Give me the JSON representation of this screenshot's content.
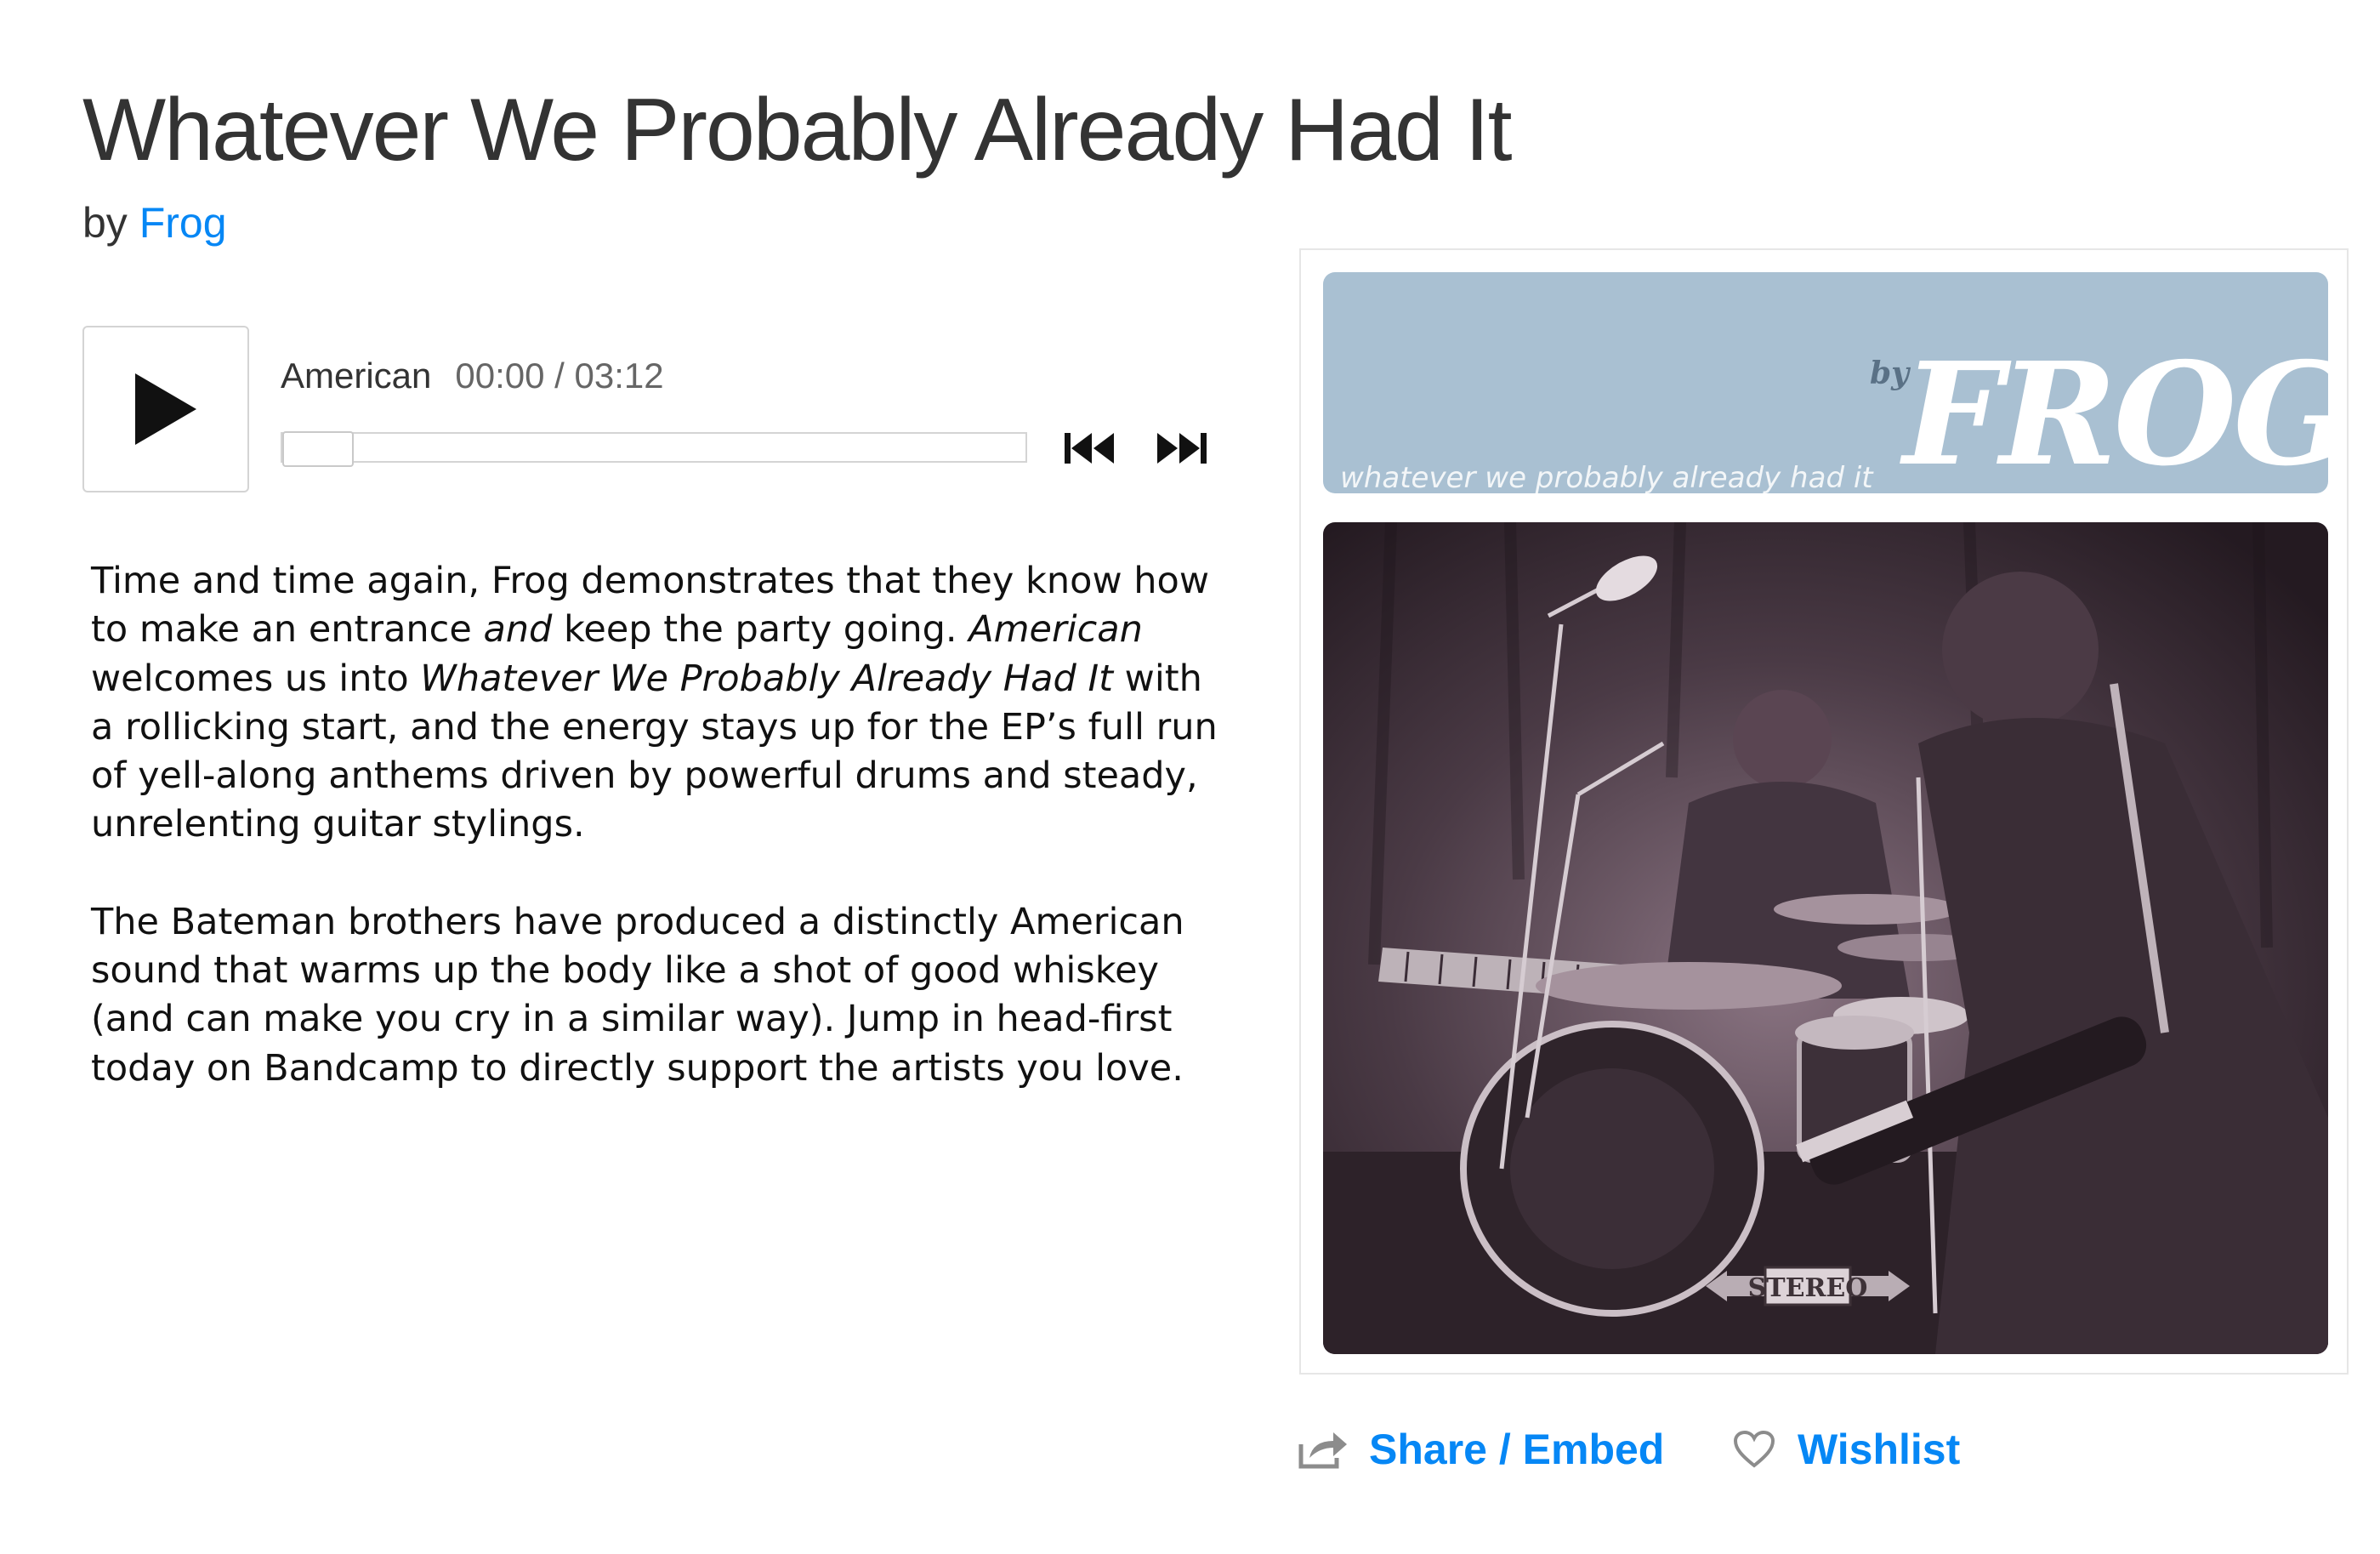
{
  "album": {
    "title": "Whatever We Probably Already Had It",
    "by_prefix": "by",
    "artist": "Frog"
  },
  "player": {
    "track_title": "American",
    "time_display": "00:00 / 03:12",
    "progress": 0,
    "icons": {
      "play": "play-icon",
      "previous": "skip-previous-icon",
      "next": "skip-next-icon"
    }
  },
  "description": {
    "p1": [
      {
        "text": "Time and time again, Frog demonstrates that they know how to make an entrance ",
        "italic": false
      },
      {
        "text": "and",
        "italic": true
      },
      {
        "text": " keep the party going. ",
        "italic": false
      },
      {
        "text": "American",
        "italic": true
      },
      {
        "text": " welcomes us into ",
        "italic": false
      },
      {
        "text": "Whatever We Probably Already Had It",
        "italic": true
      },
      {
        "text": " with a rollicking start, and the energy stays up for the EP’s full run of yell-along anthems driven by powerful drums and steady, unrelenting guitar stylings.",
        "italic": false
      }
    ],
    "p2": "The Bateman brothers have produced a distinctly American sound that warms up the body like a shot of good whiskey (and can make you cry in a similar way). Jump in head-first today on Bandcamp to directly support the artists you love."
  },
  "cover_art": {
    "banner_subtitle": "whatever we probably already had it",
    "banner_by": "by",
    "banner_band": "FROG",
    "stereo_label": "STEREO",
    "banner_color": "#a9c0d2",
    "photo_tint": "#3a2c36"
  },
  "actions": {
    "share_label": "Share / Embed",
    "wishlist_label": "Wishlist",
    "link_color": "#0687f5",
    "icons": {
      "share": "share-arrow-icon",
      "wishlist": "heart-outline-icon"
    }
  }
}
